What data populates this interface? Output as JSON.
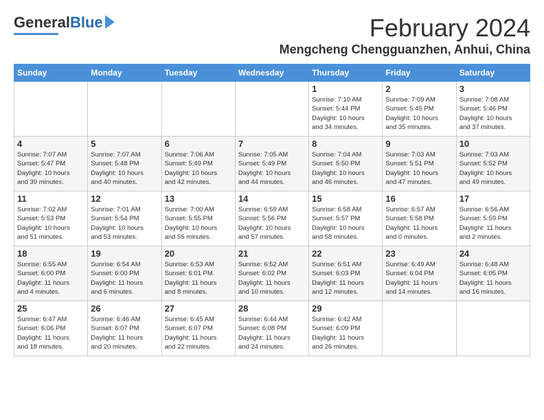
{
  "header": {
    "logo_general": "General",
    "logo_blue": "Blue",
    "month_title": "February 2024",
    "location": "Mengcheng Chengguanzhen, Anhui, China"
  },
  "weekdays": [
    "Sunday",
    "Monday",
    "Tuesday",
    "Wednesday",
    "Thursday",
    "Friday",
    "Saturday"
  ],
  "weeks": [
    [
      {
        "day": "",
        "info": ""
      },
      {
        "day": "",
        "info": ""
      },
      {
        "day": "",
        "info": ""
      },
      {
        "day": "",
        "info": ""
      },
      {
        "day": "1",
        "info": "Sunrise: 7:10 AM\nSunset: 5:44 PM\nDaylight: 10 hours\nand 34 minutes."
      },
      {
        "day": "2",
        "info": "Sunrise: 7:09 AM\nSunset: 5:45 PM\nDaylight: 10 hours\nand 35 minutes."
      },
      {
        "day": "3",
        "info": "Sunrise: 7:08 AM\nSunset: 5:46 PM\nDaylight: 10 hours\nand 37 minutes."
      }
    ],
    [
      {
        "day": "4",
        "info": "Sunrise: 7:07 AM\nSunset: 5:47 PM\nDaylight: 10 hours\nand 39 minutes."
      },
      {
        "day": "5",
        "info": "Sunrise: 7:07 AM\nSunset: 5:48 PM\nDaylight: 10 hours\nand 40 minutes."
      },
      {
        "day": "6",
        "info": "Sunrise: 7:06 AM\nSunset: 5:49 PM\nDaylight: 10 hours\nand 42 minutes."
      },
      {
        "day": "7",
        "info": "Sunrise: 7:05 AM\nSunset: 5:49 PM\nDaylight: 10 hours\nand 44 minutes."
      },
      {
        "day": "8",
        "info": "Sunrise: 7:04 AM\nSunset: 5:50 PM\nDaylight: 10 hours\nand 46 minutes."
      },
      {
        "day": "9",
        "info": "Sunrise: 7:03 AM\nSunset: 5:51 PM\nDaylight: 10 hours\nand 47 minutes."
      },
      {
        "day": "10",
        "info": "Sunrise: 7:03 AM\nSunset: 5:52 PM\nDaylight: 10 hours\nand 49 minutes."
      }
    ],
    [
      {
        "day": "11",
        "info": "Sunrise: 7:02 AM\nSunset: 5:53 PM\nDaylight: 10 hours\nand 51 minutes."
      },
      {
        "day": "12",
        "info": "Sunrise: 7:01 AM\nSunset: 5:54 PM\nDaylight: 10 hours\nand 53 minutes."
      },
      {
        "day": "13",
        "info": "Sunrise: 7:00 AM\nSunset: 5:55 PM\nDaylight: 10 hours\nand 55 minutes."
      },
      {
        "day": "14",
        "info": "Sunrise: 6:59 AM\nSunset: 5:56 PM\nDaylight: 10 hours\nand 57 minutes."
      },
      {
        "day": "15",
        "info": "Sunrise: 6:58 AM\nSunset: 5:57 PM\nDaylight: 10 hours\nand 58 minutes."
      },
      {
        "day": "16",
        "info": "Sunrise: 6:57 AM\nSunset: 5:58 PM\nDaylight: 11 hours\nand 0 minutes."
      },
      {
        "day": "17",
        "info": "Sunrise: 6:56 AM\nSunset: 5:59 PM\nDaylight: 11 hours\nand 2 minutes."
      }
    ],
    [
      {
        "day": "18",
        "info": "Sunrise: 6:55 AM\nSunset: 6:00 PM\nDaylight: 11 hours\nand 4 minutes."
      },
      {
        "day": "19",
        "info": "Sunrise: 6:54 AM\nSunset: 6:00 PM\nDaylight: 11 hours\nand 6 minutes."
      },
      {
        "day": "20",
        "info": "Sunrise: 6:53 AM\nSunset: 6:01 PM\nDaylight: 11 hours\nand 8 minutes."
      },
      {
        "day": "21",
        "info": "Sunrise: 6:52 AM\nSunset: 6:02 PM\nDaylight: 11 hours\nand 10 minutes."
      },
      {
        "day": "22",
        "info": "Sunrise: 6:51 AM\nSunset: 6:03 PM\nDaylight: 11 hours\nand 12 minutes."
      },
      {
        "day": "23",
        "info": "Sunrise: 6:49 AM\nSunset: 6:04 PM\nDaylight: 11 hours\nand 14 minutes."
      },
      {
        "day": "24",
        "info": "Sunrise: 6:48 AM\nSunset: 6:05 PM\nDaylight: 11 hours\nand 16 minutes."
      }
    ],
    [
      {
        "day": "25",
        "info": "Sunrise: 6:47 AM\nSunset: 6:06 PM\nDaylight: 11 hours\nand 18 minutes."
      },
      {
        "day": "26",
        "info": "Sunrise: 6:46 AM\nSunset: 6:07 PM\nDaylight: 11 hours\nand 20 minutes."
      },
      {
        "day": "27",
        "info": "Sunrise: 6:45 AM\nSunset: 6:07 PM\nDaylight: 11 hours\nand 22 minutes."
      },
      {
        "day": "28",
        "info": "Sunrise: 6:44 AM\nSunset: 6:08 PM\nDaylight: 11 hours\nand 24 minutes."
      },
      {
        "day": "29",
        "info": "Sunrise: 6:42 AM\nSunset: 6:09 PM\nDaylight: 11 hours\nand 26 minutes."
      },
      {
        "day": "",
        "info": ""
      },
      {
        "day": "",
        "info": ""
      }
    ]
  ]
}
